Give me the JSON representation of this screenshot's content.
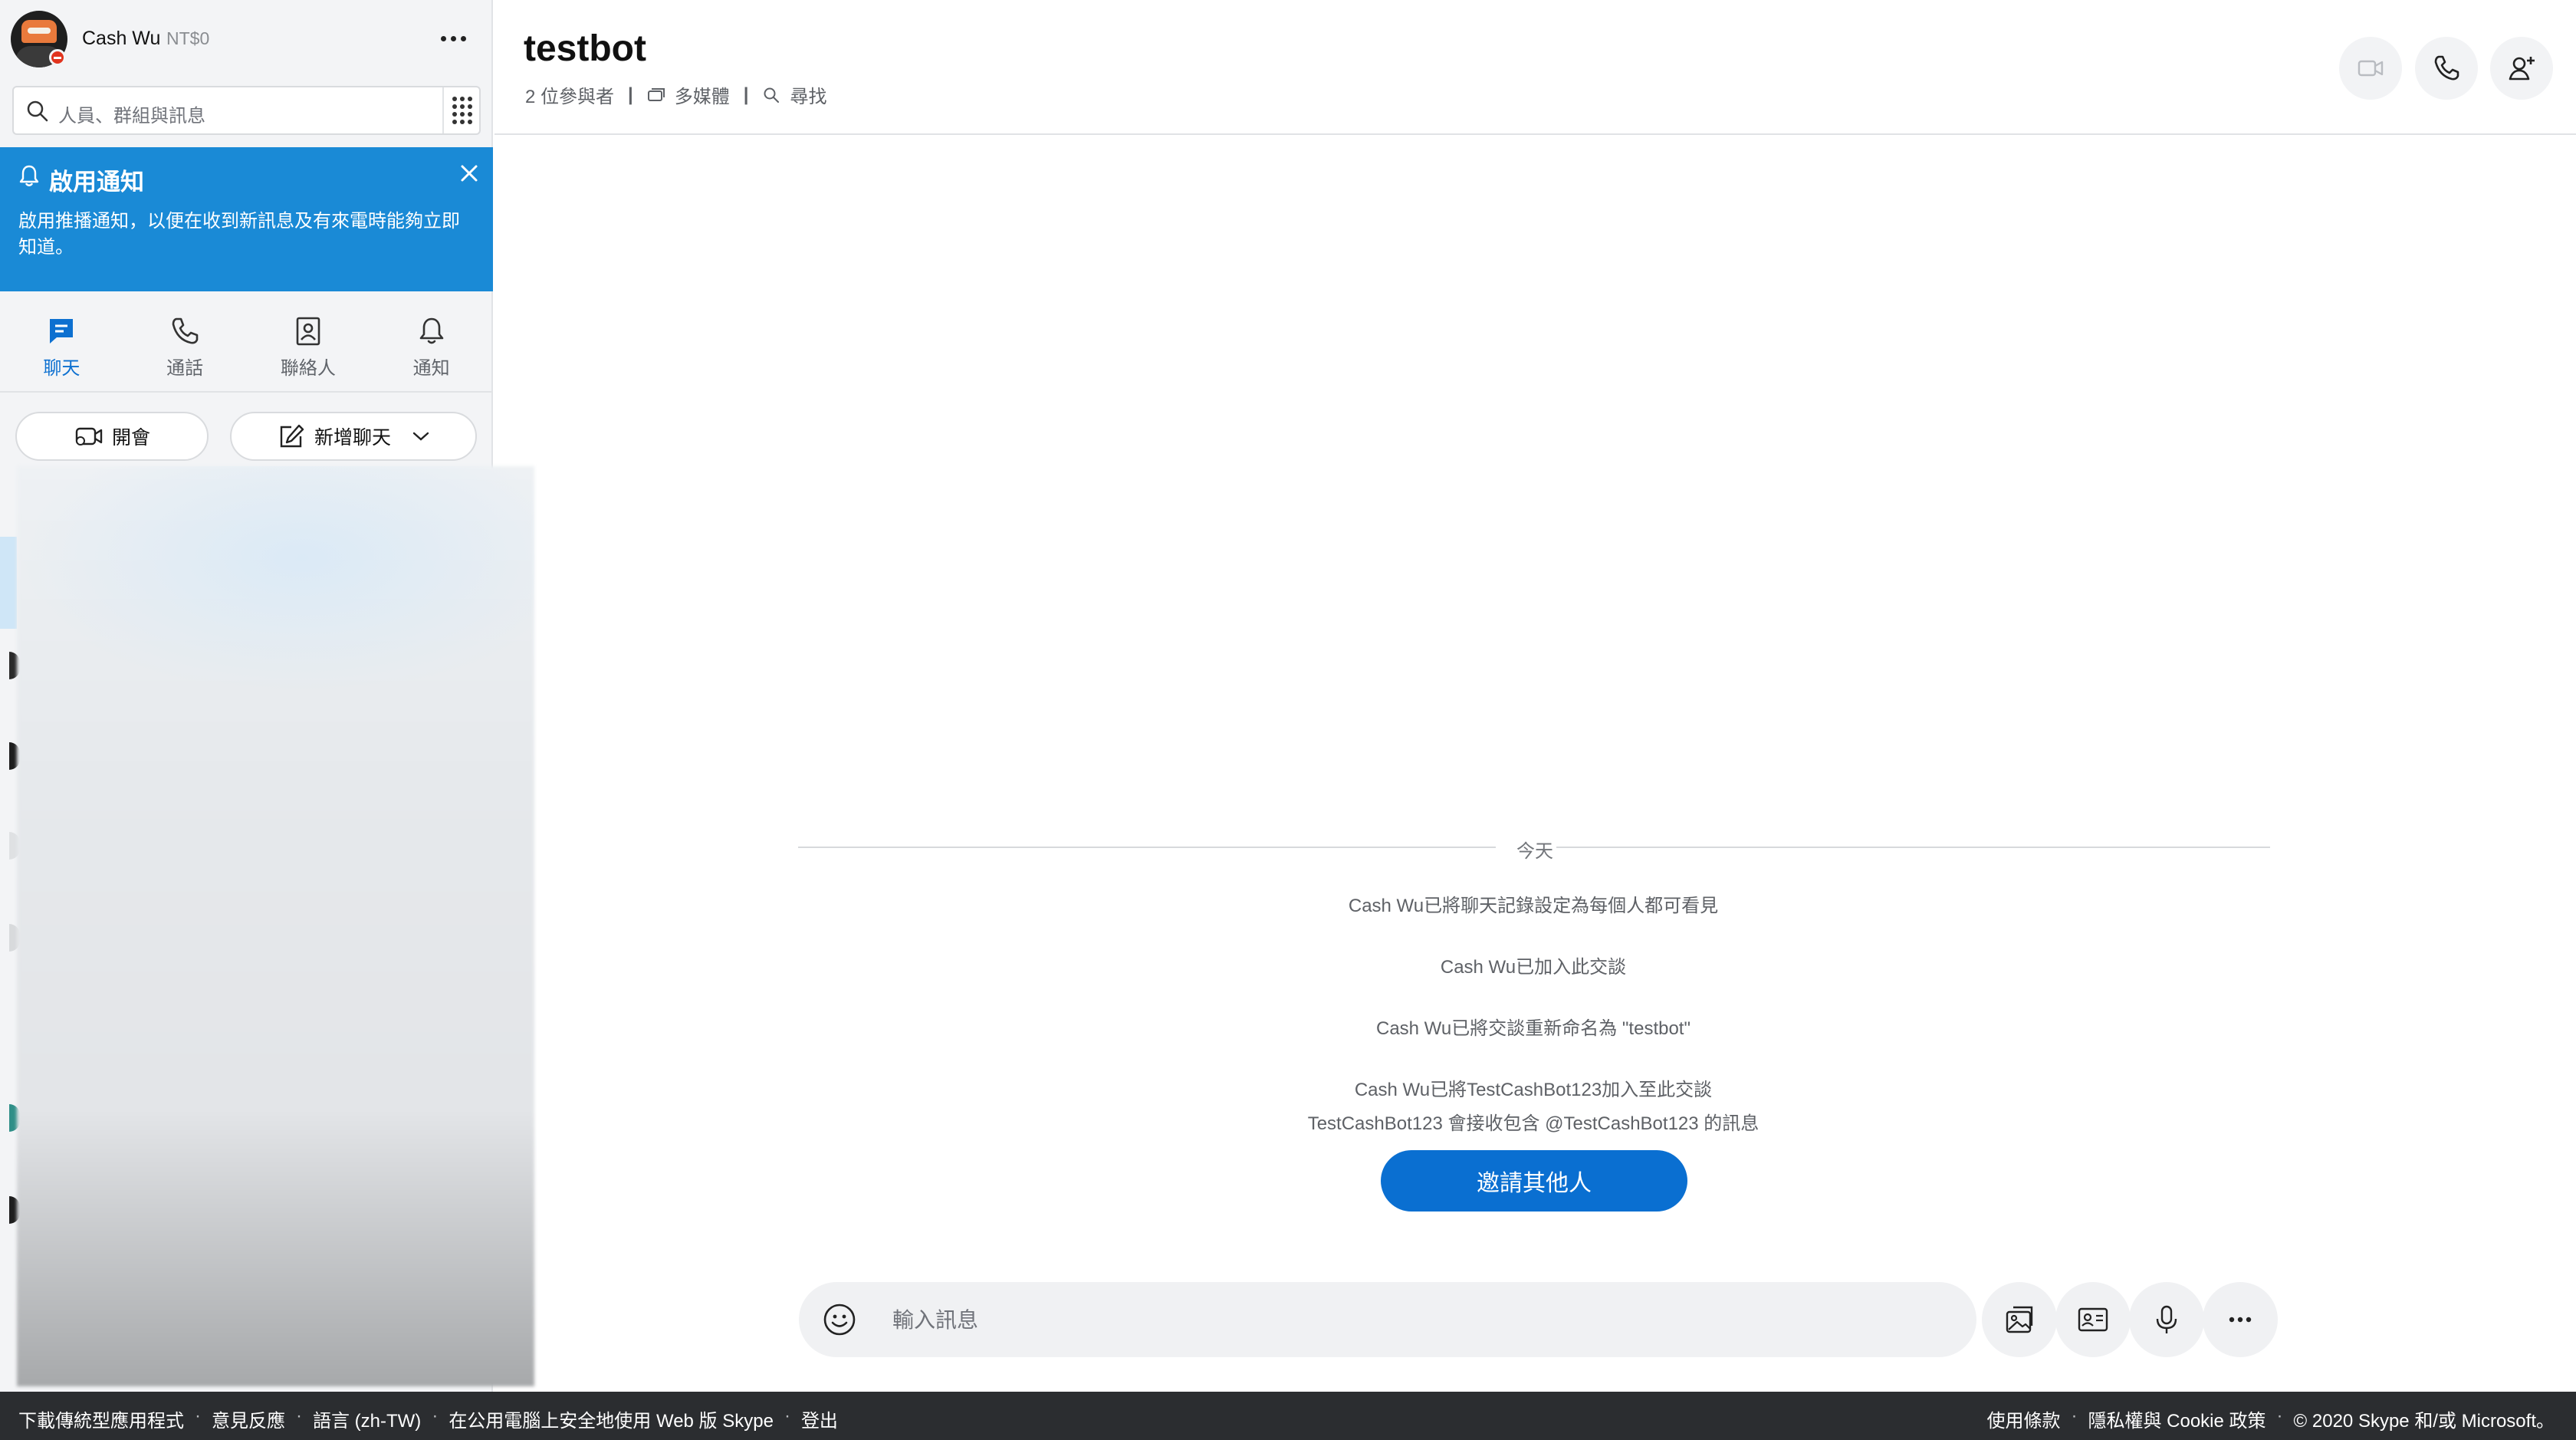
{
  "profile": {
    "name": "Cash Wu",
    "credit": "NT$0"
  },
  "search": {
    "placeholder": "人員、群組與訊息"
  },
  "notification_banner": {
    "title": "啟用通知",
    "body": "啟用推播通知，以便在收到新訊息及有來電時能夠立即知道。"
  },
  "nav": {
    "items": [
      {
        "label": "聊天",
        "icon": "chat-icon",
        "active": true
      },
      {
        "label": "通話",
        "icon": "phone-icon",
        "active": false
      },
      {
        "label": "聯絡人",
        "icon": "contacts-icon",
        "active": false
      },
      {
        "label": "通知",
        "icon": "bell-icon",
        "active": false
      }
    ]
  },
  "actions": {
    "meet_label": "開會",
    "new_chat_label": "新增聊天"
  },
  "chat": {
    "title": "testbot",
    "participants": "2 位參與者",
    "media": "多媒體",
    "find": "尋找",
    "date_divider": "今天",
    "system_messages": [
      "Cash Wu已將聊天記錄設定為每個人都可看見",
      "Cash Wu已加入此交談",
      "Cash Wu已將交談重新命名為 \"testbot\"",
      "Cash Wu已將TestCashBot123加入至此交談",
      "TestCashBot123 會接收包含 @TestCashBot123 的訊息"
    ],
    "invite_label": "邀請其他人"
  },
  "composer": {
    "placeholder": "輸入訊息"
  },
  "footer": {
    "left_links": [
      "下載傳統型應用程式",
      "意見反應",
      "語言 (zh-TW)",
      "在公用電腦上安全地使用 Web 版 Skype",
      "登出"
    ],
    "right_links": [
      "使用條款",
      "隱私權與 Cookie 政策",
      "© 2020 Skype 和/或 Microsoft。"
    ]
  },
  "colors": {
    "accent": "#0a6fd1",
    "banner": "#1a8ad6",
    "footer_bg": "#2b2d30"
  }
}
